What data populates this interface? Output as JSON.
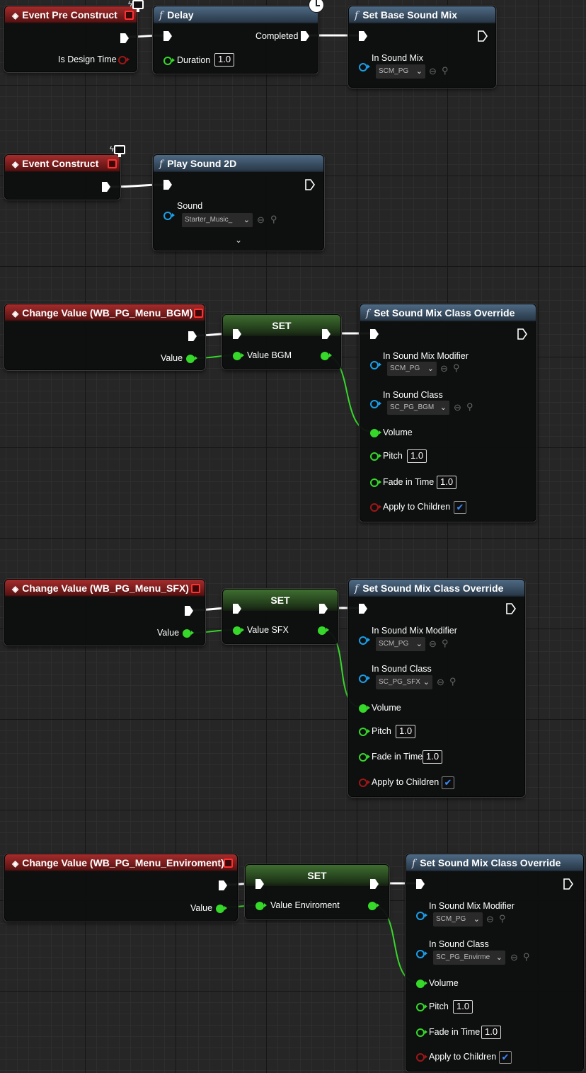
{
  "colors": {
    "exec_wire": "#ffffff",
    "float_wire": "#36d82a",
    "object_pin": "#1a9ee8",
    "bool_pin": "#a01616",
    "event_header": "#a52c2c",
    "function_header": "#4e6a84",
    "set_header": "#3e6e30"
  },
  "icons": {
    "event": "event-diamond-icon",
    "function": "function-f-icon",
    "latent": "clock-icon",
    "client_only": "monitor-icon",
    "delegate": "delegate-square-icon",
    "browse": "browse-arrow-icon",
    "search": "search-icon"
  },
  "row1": {
    "event": {
      "title": "Event Pre Construct",
      "pin_design_time": "Is Design Time"
    },
    "delay": {
      "title": "Delay",
      "pin_completed": "Completed",
      "pin_duration": "Duration",
      "duration_value": "1.0"
    },
    "setmix": {
      "title": "Set Base Sound Mix",
      "pin_in_sound_mix": "In Sound Mix",
      "sound_mix_value": "SCM_PG"
    }
  },
  "row2": {
    "event": {
      "title": "Event Construct"
    },
    "play": {
      "title": "Play Sound 2D",
      "pin_sound": "Sound",
      "sound_value": "Starter_Music_"
    }
  },
  "groups": [
    {
      "event_title": "Change Value (WB_PG_Menu_BGM)",
      "event_value_label": "Value",
      "set_title": "SET",
      "set_value_label": "Value BGM",
      "override_title": "Set Sound Mix Class Override",
      "modifier_label": "In Sound Mix Modifier",
      "modifier_value": "SCM_PG",
      "class_label": "In Sound Class",
      "class_value": "SC_PG_BGM",
      "volume_label": "Volume",
      "pitch_label": "Pitch",
      "pitch_value": "1.0",
      "fade_label": "Fade in Time",
      "fade_value": "1.0",
      "apply_label": "Apply to Children",
      "apply_checked": true
    },
    {
      "event_title": "Change Value (WB_PG_Menu_SFX)",
      "event_value_label": "Value",
      "set_title": "SET",
      "set_value_label": "Value SFX",
      "override_title": "Set Sound Mix Class Override",
      "modifier_label": "In Sound Mix Modifier",
      "modifier_value": "SCM_PG",
      "class_label": "In Sound Class",
      "class_value": "SC_PG_SFX",
      "volume_label": "Volume",
      "pitch_label": "Pitch",
      "pitch_value": "1.0",
      "fade_label": "Fade in Time",
      "fade_value": "1.0",
      "apply_label": "Apply to Children",
      "apply_checked": true
    },
    {
      "event_title": "Change Value (WB_PG_Menu_Enviroment)",
      "event_value_label": "Value",
      "set_title": "SET",
      "set_value_label": "Value Enviroment",
      "override_title": "Set Sound Mix Class Override",
      "modifier_label": "In Sound Mix Modifier",
      "modifier_value": "SCM_PG",
      "class_label": "In Sound Class",
      "class_value": "SC_PG_Envirme",
      "volume_label": "Volume",
      "pitch_label": "Pitch",
      "pitch_value": "1.0",
      "fade_label": "Fade in Time",
      "fade_value": "1.0",
      "apply_label": "Apply to Children",
      "apply_checked": true
    }
  ]
}
